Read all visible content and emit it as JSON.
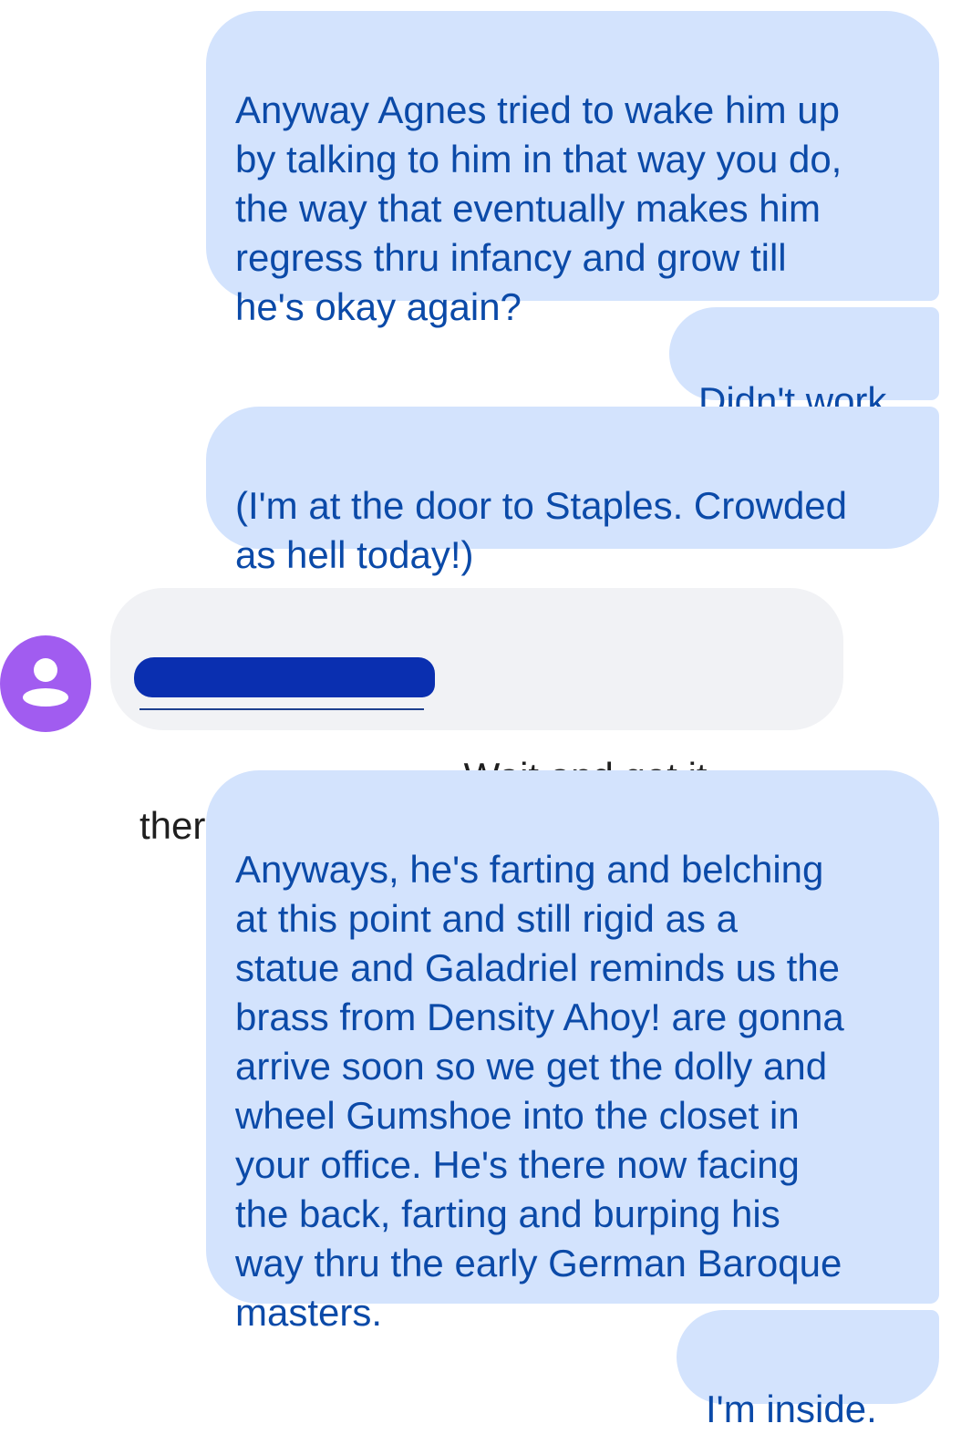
{
  "conversation": {
    "messages": [
      {
        "direction": "sent",
        "text": "Anyway Agnes tried to wake him up\nby talking to him in that way you do,\nthe way that eventually makes him\nregress thru infancy and grow till\nhe's okay again?"
      },
      {
        "direction": "sent",
        "text": "Didn't work."
      },
      {
        "direction": "sent",
        "text": "(I'm at the door to Staples.  Crowded\nas hell today!)"
      },
      {
        "direction": "received",
        "text": "- Wait and get it\nthere",
        "redacted_prefix": true,
        "sender_icon": "person-icon"
      },
      {
        "direction": "sent",
        "text": "Anyways, he's farting and belching\nat this point and still rigid as a\nstatue and Galadriel reminds us the\nbrass from Density Ahoy! are gonna\narrive soon so we get the dolly and\nwheel Gumshoe into the closet in\nyour office.  He's there now facing\nthe back, farting and burping his\nway thru the early German Baroque\nmasters."
      },
      {
        "direction": "sent",
        "text": "I'm inside."
      }
    ]
  },
  "colors": {
    "sent_bubble": "#d3e3fd",
    "sent_text": "#0b4aa8",
    "received_bubble": "#f1f2f5",
    "received_text": "#1f1f1f",
    "avatar_background": "#a15cf0",
    "redaction_mark": "#0a2fb0"
  }
}
